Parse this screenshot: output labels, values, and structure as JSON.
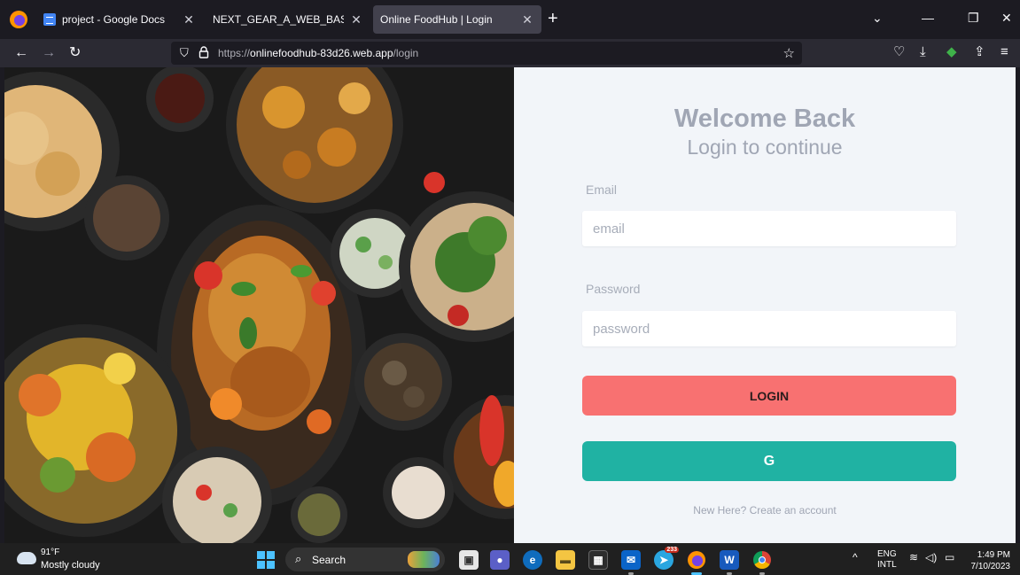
{
  "browser": {
    "tabs": [
      {
        "title": "project - Google Docs",
        "active": false,
        "icon": "google-docs-icon"
      },
      {
        "title": "NEXT_GEAR_A_WEB_BASED_APPLIC",
        "active": false,
        "icon": "none"
      },
      {
        "title": "Online FoodHub | Login",
        "active": true,
        "icon": "none"
      }
    ],
    "url": {
      "scheme": "https://",
      "host": "onlinefoodhub-83d26.web.app",
      "path": "/login"
    }
  },
  "hero": {
    "description_icon": "food-platter-image"
  },
  "login": {
    "heading": "Welcome Back",
    "subheading": "Login to continue",
    "email_label": "Email",
    "email_placeholder": "email",
    "password_label": "Password",
    "password_placeholder": "password",
    "login_button": "LOGIN",
    "google_button": "G",
    "signup_link": "New Here? Create an account",
    "colors": {
      "login_button": "#f87171",
      "google_button": "#20b2a3",
      "panel_bg": "#f2f5f9",
      "heading": "#a0a6b4"
    }
  },
  "taskbar": {
    "weather_temp": "91°F",
    "weather_cond": "Mostly cloudy",
    "search_label": "Search",
    "telegram_badge": "233",
    "lang_line1": "ENG",
    "lang_line2": "INTL",
    "time": "1:49 PM",
    "date": "7/10/2023"
  }
}
